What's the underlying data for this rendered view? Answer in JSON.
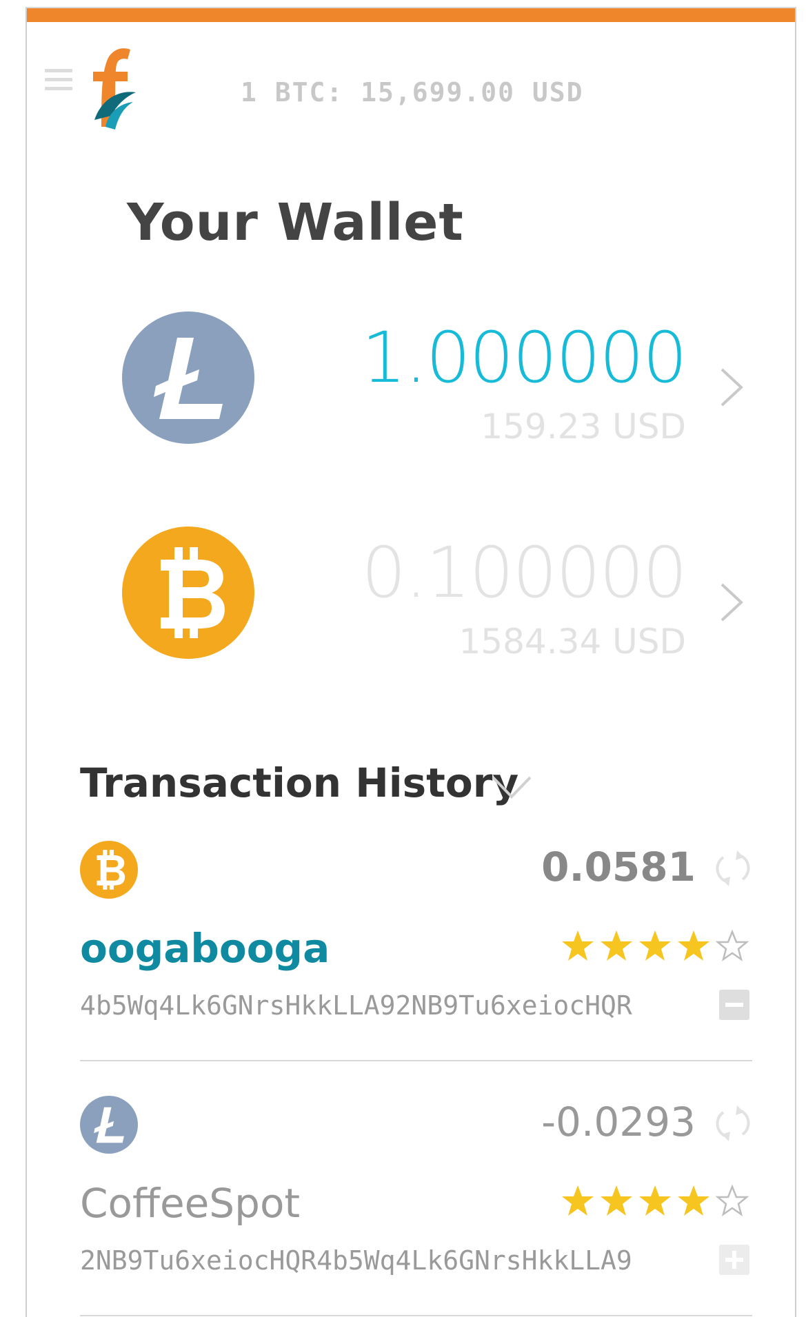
{
  "header": {
    "rate_text": "1 BTC: 15,699.00 USD",
    "menu_icon": "hamburger-menu-icon",
    "logo_icon": "app-logo-f"
  },
  "page": {
    "title": "Your Wallet"
  },
  "wallets": [
    {
      "coin": "litecoin",
      "amount": "1.000000",
      "usd": "159.23 USD",
      "color": "#8ba0bd",
      "amount_color": "#17bbd8"
    },
    {
      "coin": "bitcoin",
      "amount": "0.100000",
      "usd": "1584.34 USD",
      "color": "#f4a81d",
      "amount_color": "#e3e3e3"
    }
  ],
  "transactions": {
    "title": "Transaction History",
    "items": [
      {
        "coin": "bitcoin",
        "amount": "0.0581",
        "name": "oogabooga",
        "address": "4b5Wq4Lk6GNrsHkkLLA92NB9Tu6xeiocHQR",
        "rating": 4,
        "rating_max": 5,
        "toggle": "collapse"
      },
      {
        "coin": "litecoin",
        "amount": "-0.0293",
        "name": "CoffeeSpot",
        "address": "2NB9Tu6xeiocHQR4b5Wq4Lk6GNrsHkkLLA9",
        "rating": 4,
        "rating_max": 5,
        "toggle": "expand"
      }
    ]
  },
  "colors": {
    "accent": "#f0862b",
    "bitcoin": "#f4a81d",
    "litecoin": "#8ba0bd",
    "star": "#f7c51f",
    "name_active": "#0f8aa0"
  }
}
